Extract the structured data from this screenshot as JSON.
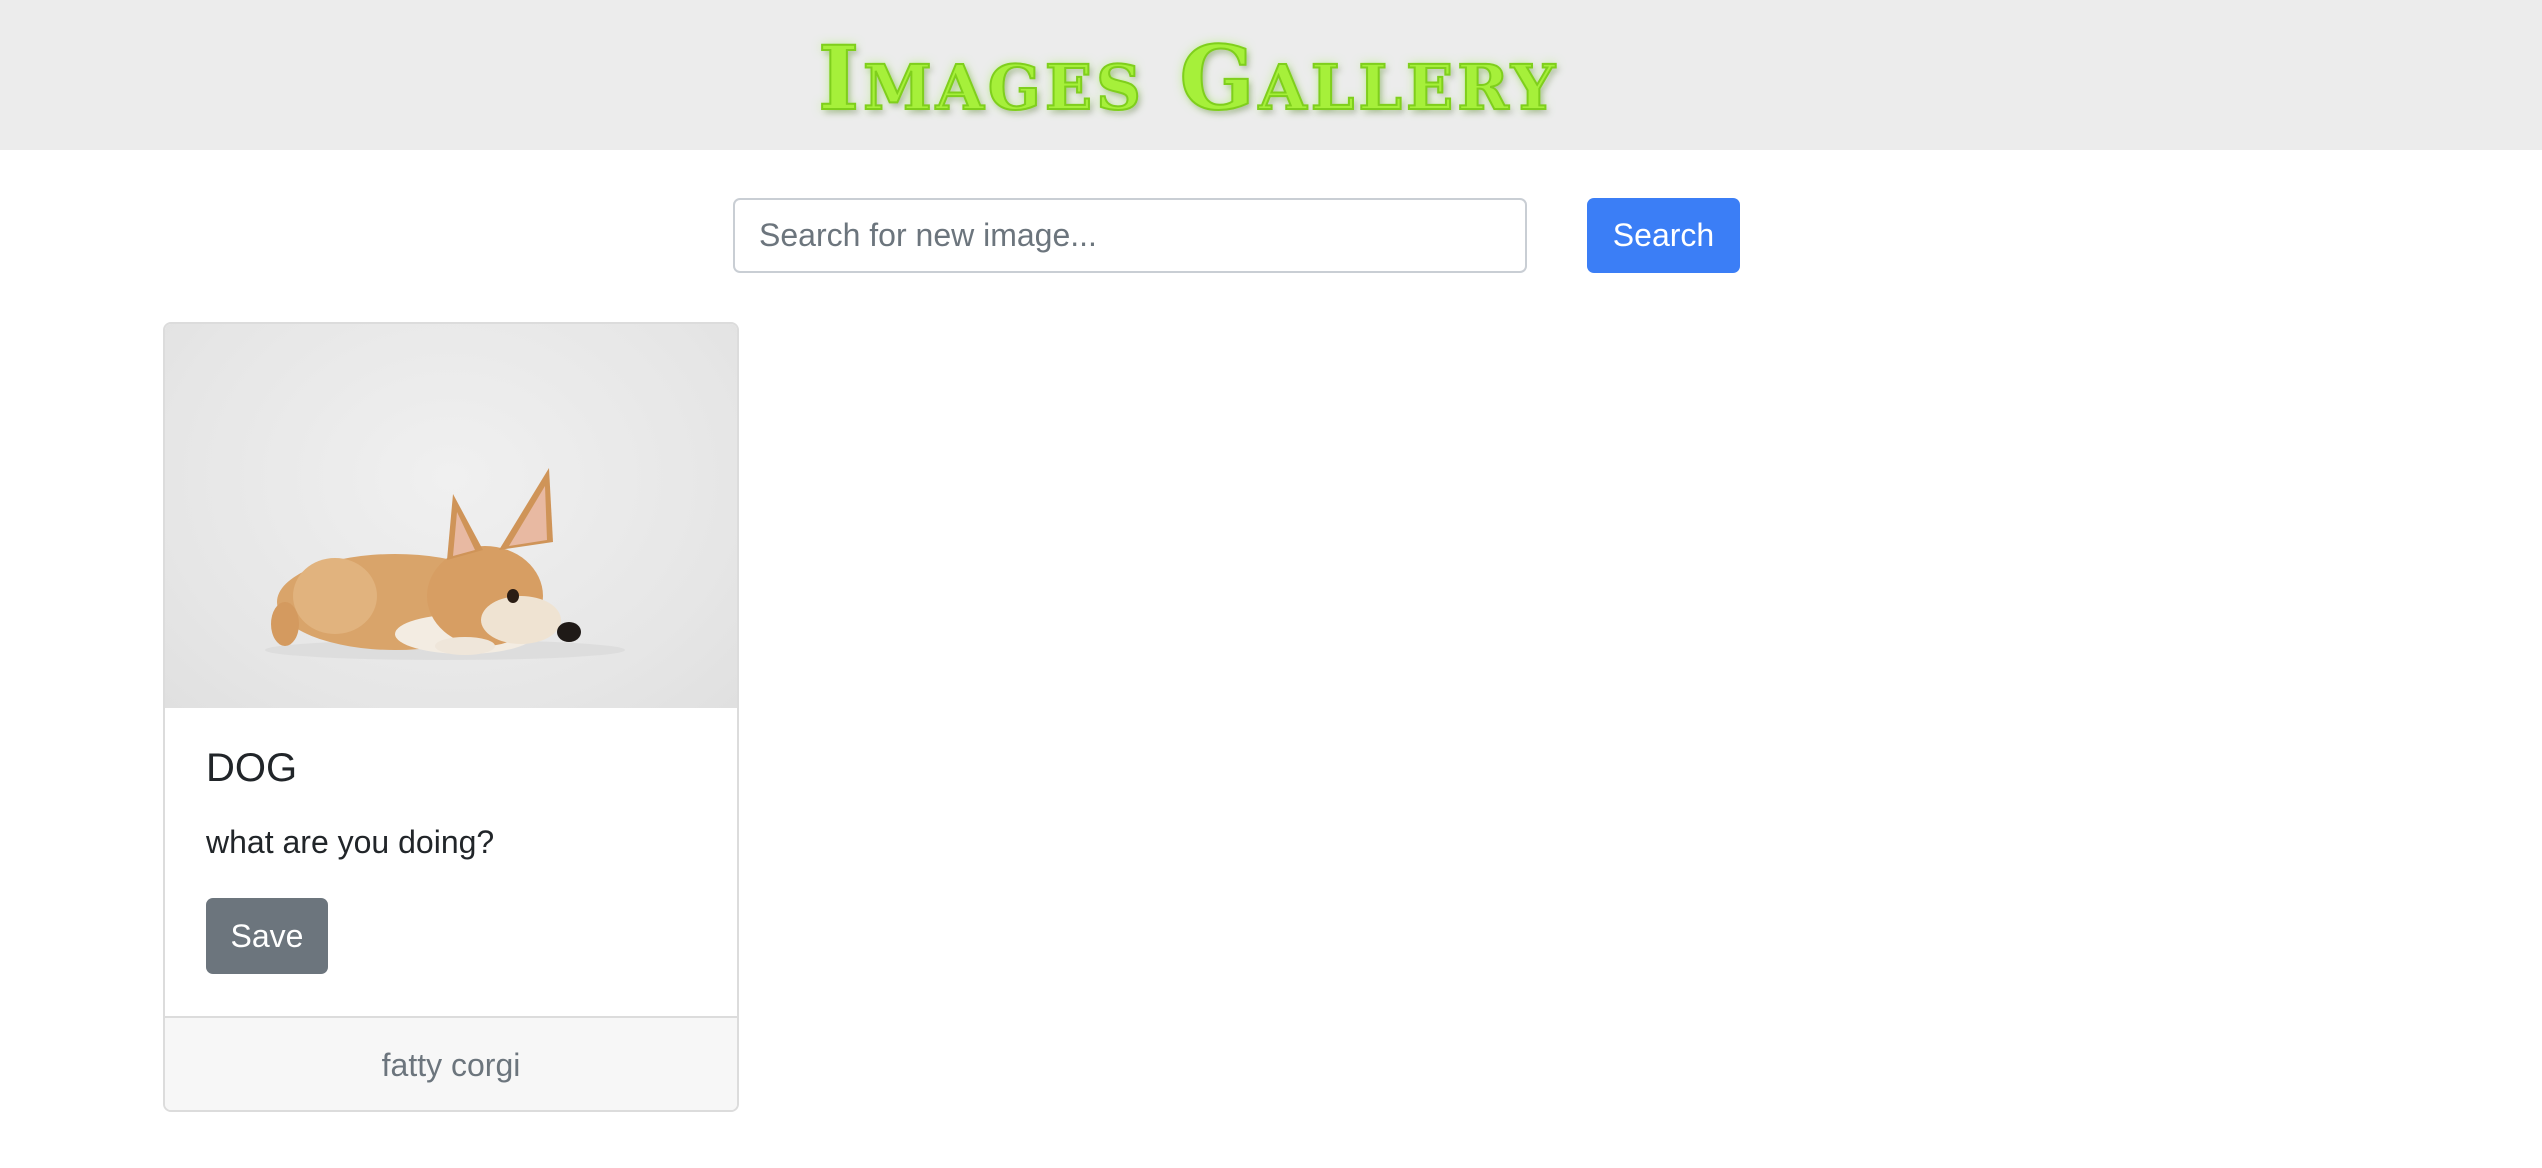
{
  "header": {
    "logo_text": "Images Gallery"
  },
  "search": {
    "placeholder": "Search for new image...",
    "value": "",
    "button_label": "Search"
  },
  "cards": [
    {
      "image_icon": "corgi-photo",
      "title": "DOG",
      "description": "what are you doing?",
      "save_label": "Save",
      "footer": "fatty corgi"
    }
  ],
  "colors": {
    "header_bg": "#ececec",
    "logo": "#a6f03a",
    "primary_button": "#3b7ef6",
    "secondary_button": "#6c757d"
  }
}
